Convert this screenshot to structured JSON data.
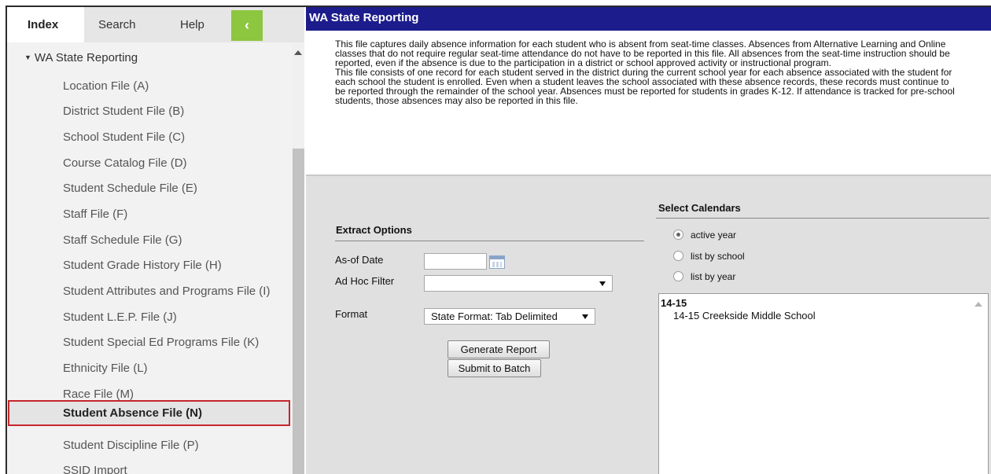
{
  "tabs": {
    "index": "Index",
    "search": "Search",
    "help": "Help",
    "collapse": "‹"
  },
  "tree": {
    "header": "WA State Reporting",
    "items": [
      "Location File (A)",
      "District Student File (B)",
      "School Student File (C)",
      "Course Catalog File (D)",
      "Student Schedule File (E)",
      "Staff File (F)",
      "Staff Schedule File (G)",
      "Student Grade History File (H)",
      "Student Attributes and Programs File (I)",
      "Student L.E.P. File (J)",
      "Student Special Ed Programs File (K)",
      "Ethnicity File (L)",
      "Race File (M)",
      "Student Absence File (N)",
      "Student Discipline File (P)",
      "SSID Import"
    ],
    "selected_index": 13
  },
  "main": {
    "title": "WA State Reporting",
    "description": [
      "This file captures daily absence information for each student who is absent from seat-time classes. Absences from Alternative Learning and Online classes that do not require regular seat-time attendance do not have to be reported in this file. All absences from the seat-time instruction should be reported, even if the absence is due to the participation in a district or school approved activity or instructional program.",
      "This file consists of one record for each student served in the district during the current school year for each absence associated with the student for each school the student is enrolled. Even when a student leaves the school associated with these absence records, these records must continue to be reported through the remainder of the school year. Absences must be reported for students in grades K-12. If attendance is tracked for pre-school students, those absences may also be reported in this file."
    ],
    "extract": {
      "title": "Extract Options",
      "as_of_date_label": "As-of Date",
      "as_of_date_value": "",
      "ad_hoc_label": "Ad Hoc Filter",
      "ad_hoc_value": "",
      "format_label": "Format",
      "format_value": "State Format: Tab Delimited",
      "generate_button": "Generate Report",
      "batch_button": "Submit to Batch"
    },
    "calendars": {
      "title": "Select Calendars",
      "options": [
        "active year",
        "list by school",
        "list by year"
      ],
      "selected_option": 0,
      "list_group": "14-15",
      "list_items": [
        "14-15 Creekside Middle School"
      ]
    }
  },
  "colors": {
    "title_bar": "#1c1c8c",
    "collapse_button": "#8dc63f",
    "selected_border": "#c6262e"
  }
}
